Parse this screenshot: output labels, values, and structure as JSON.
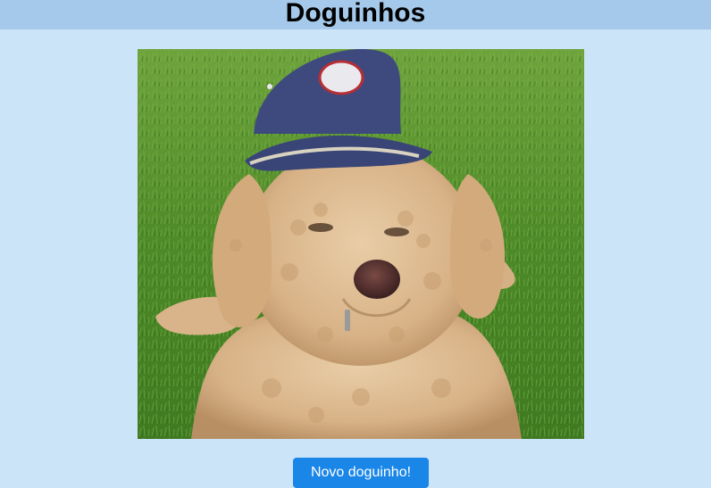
{
  "header": {
    "title": "Doguinhos"
  },
  "photo": {
    "alt": "dog-photo",
    "subject": "fluffy-dog-with-cap-icon"
  },
  "actions": {
    "new_dog_label": "Novo doguinho!"
  },
  "colors": {
    "page_background": "#cce4f7",
    "header_background": "#a4c9ea",
    "button_background": "#1a86e8",
    "button_text": "#ffffff"
  }
}
